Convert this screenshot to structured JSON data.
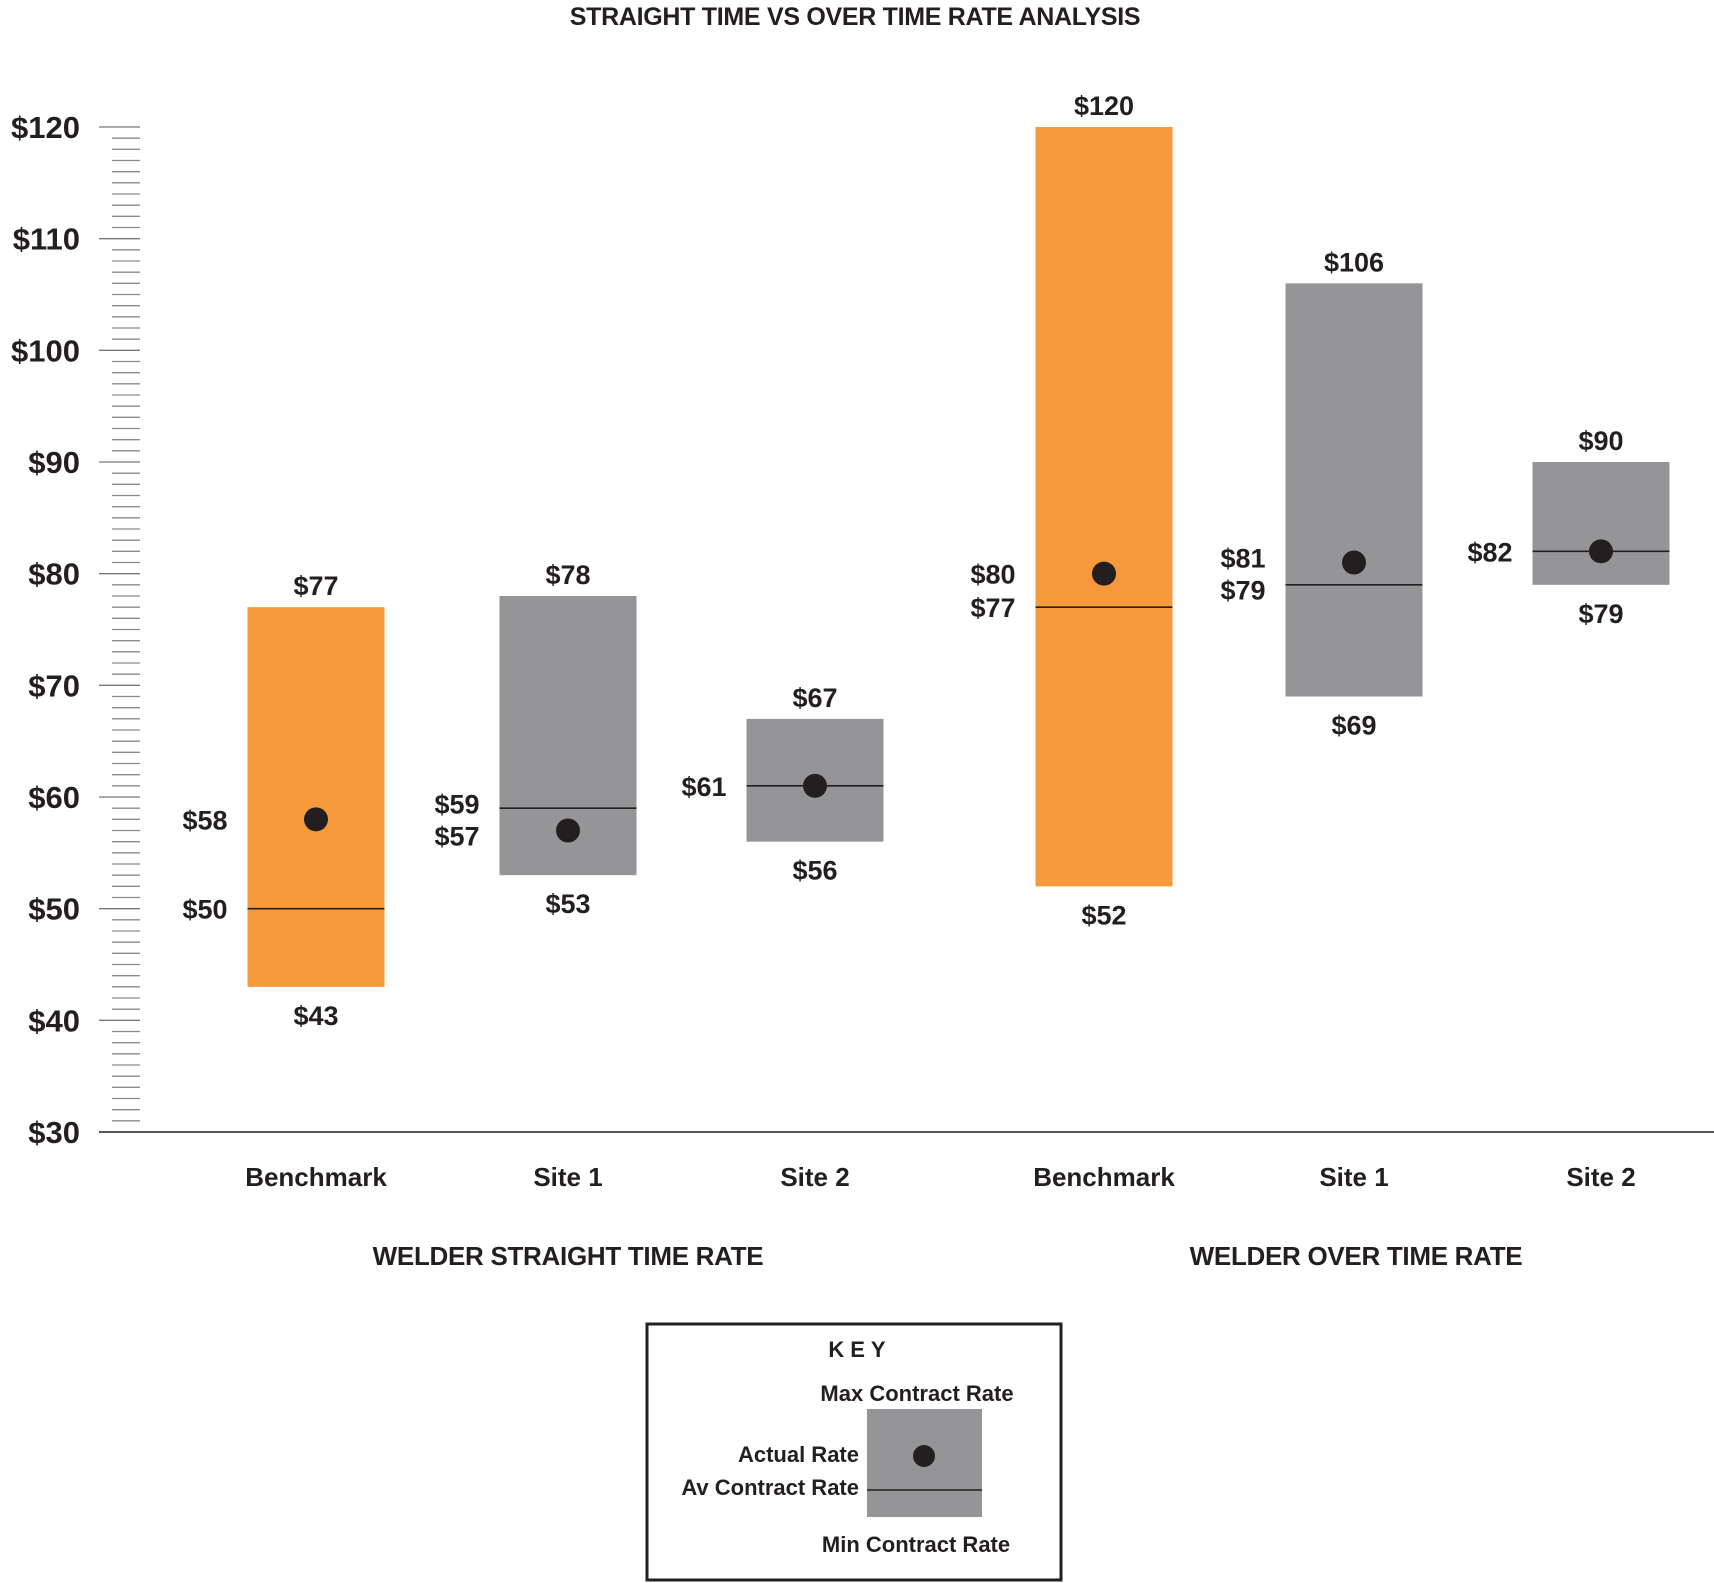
{
  "chart_data": {
    "type": "range-bar",
    "title": "STRAIGHT TIME VS OVER TIME RATE ANALYSIS",
    "xlabel": "",
    "ylabel": "",
    "ylim": [
      30,
      120
    ],
    "y_major_step": 10,
    "y_minor_step": 1,
    "y_ticks": [
      "$30",
      "$40",
      "$50",
      "$60",
      "$70",
      "$80",
      "$90",
      "$100",
      "$110",
      "$120"
    ],
    "grid": false,
    "legend": "bottom-center",
    "currency": "$",
    "colors": {
      "benchmark": "#F6993A",
      "site": "#959598",
      "marker": "#231F20",
      "text": "#231F20",
      "axis": "#555555"
    },
    "groups": [
      {
        "name": "WELDER STRAIGHT TIME RATE",
        "items": [
          {
            "category": "Benchmark",
            "kind": "benchmark",
            "max": 77,
            "min": 43,
            "avg": 50,
            "actual": 58,
            "labels": {
              "max": "$77",
              "min": "$43",
              "avg": "$50",
              "actual": "$58"
            }
          },
          {
            "category": "Site 1",
            "kind": "site",
            "max": 78,
            "min": 53,
            "avg": 59,
            "actual": 57,
            "labels": {
              "max": "$78",
              "min": "$53",
              "avg": "$59",
              "actual": "$57"
            }
          },
          {
            "category": "Site 2",
            "kind": "site",
            "max": 67,
            "min": 56,
            "avg": 61,
            "actual": 61,
            "labels": {
              "max": "$67",
              "min": "$56",
              "combined": "$61"
            }
          }
        ]
      },
      {
        "name": "WELDER OVER TIME RATE",
        "items": [
          {
            "category": "Benchmark",
            "kind": "benchmark",
            "max": 120,
            "min": 52,
            "avg": 77,
            "actual": 80,
            "labels": {
              "max": "$120",
              "min": "$52",
              "avg": "$77",
              "actual": "$80"
            }
          },
          {
            "category": "Site 1",
            "kind": "site",
            "max": 106,
            "min": 69,
            "avg": 79,
            "actual": 81,
            "labels": {
              "max": "$106",
              "min": "$69",
              "avg": "$79",
              "actual": "$81"
            }
          },
          {
            "category": "Site 2",
            "kind": "site",
            "max": 90,
            "min": 79,
            "avg": 82,
            "actual": 82,
            "labels": {
              "max": "$90",
              "min": "$79",
              "combined": "$82"
            }
          }
        ]
      }
    ],
    "key": {
      "title": "KEY",
      "max_label": "Max Contract Rate",
      "actual_label": "Actual Rate",
      "avg_label": "Av Contract Rate",
      "min_label": "Min Contract Rate"
    }
  }
}
